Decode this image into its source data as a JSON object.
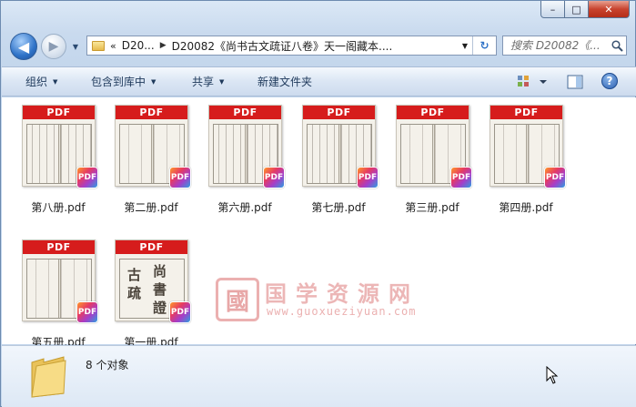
{
  "window": {
    "caption": {
      "minimize": "–",
      "maximize": "□",
      "close": "✕"
    }
  },
  "nav": {
    "back_icon": "arrow-left-icon",
    "forward_icon": "arrow-right-icon"
  },
  "address": {
    "lead": "«",
    "crumbs": [
      "D20...",
      "D20082《尚书古文疏证八卷》天一阁藏本...."
    ],
    "drop": "▾",
    "refresh": "↻"
  },
  "search": {
    "placeholder": "搜索 D20082《...",
    "icon": "search-icon"
  },
  "toolbar": {
    "organize": "组织",
    "include": "包含到库中",
    "share": "共享",
    "new_folder": "新建文件夹",
    "help": "?"
  },
  "files": [
    {
      "name": "第八册.pdf",
      "thumb_label": "PDF",
      "badge": "PDF"
    },
    {
      "name": "第二册.pdf",
      "thumb_label": "PDF",
      "badge": "PDF"
    },
    {
      "name": "第六册.pdf",
      "thumb_label": "PDF",
      "badge": "PDF"
    },
    {
      "name": "第七册.pdf",
      "thumb_label": "PDF",
      "badge": "PDF"
    },
    {
      "name": "第三册.pdf",
      "thumb_label": "PDF",
      "badge": "PDF"
    },
    {
      "name": "第四册.pdf",
      "thumb_label": "PDF",
      "badge": "PDF"
    },
    {
      "name": "第五册.pdf",
      "thumb_label": "PDF",
      "badge": "PDF"
    },
    {
      "name": "第一册.pdf",
      "thumb_label": "PDF",
      "badge": "PDF"
    }
  ],
  "watermark": {
    "logo": "國",
    "title": "国学资源网",
    "url": "www.guoxueziyuan.com"
  },
  "status": {
    "count": "8 个对象"
  },
  "colors": {
    "pdf_red": "#d61c1c",
    "accent": "#2f73c8"
  }
}
